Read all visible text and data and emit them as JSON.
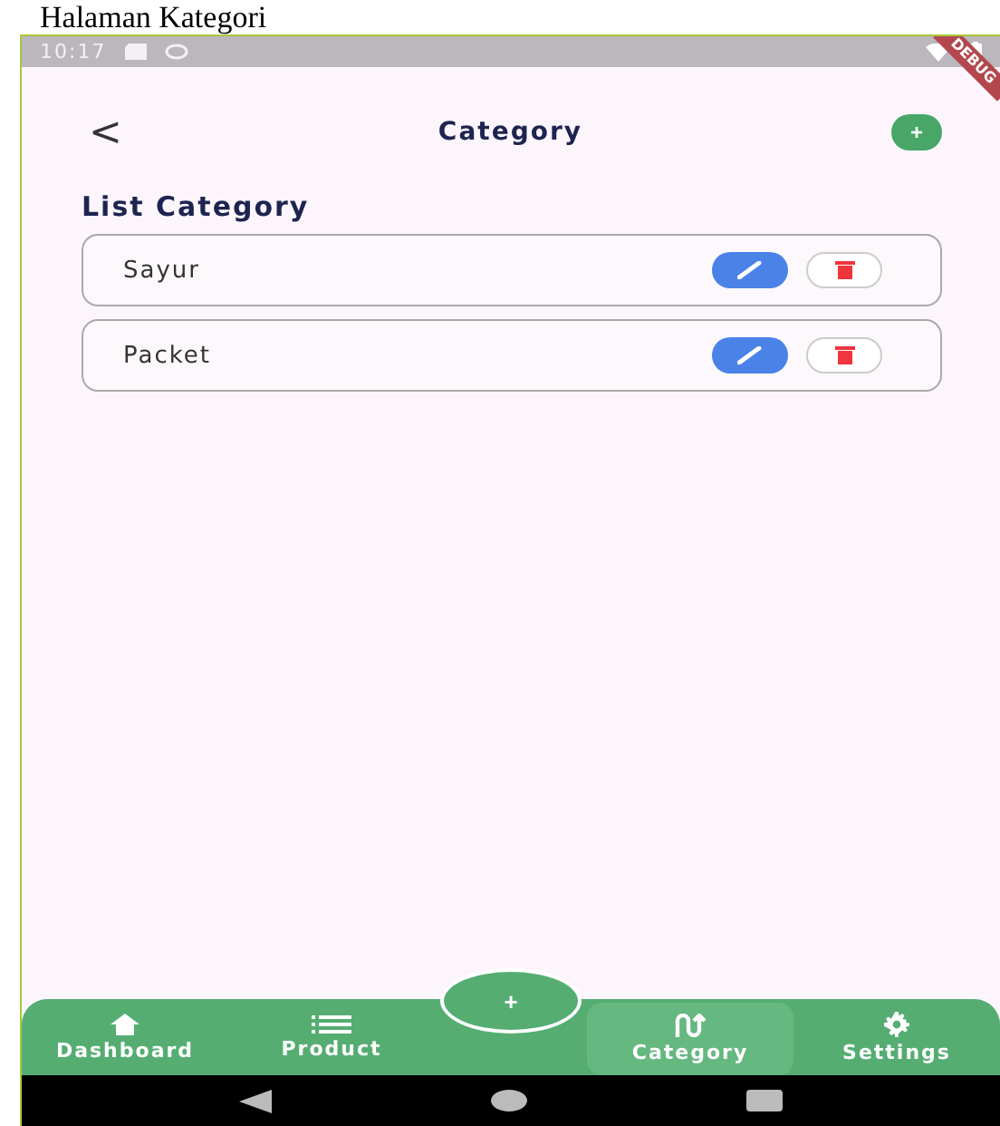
{
  "caption": "Halaman Kategori",
  "status_bar": {
    "time": "10:17"
  },
  "debug_banner": "DEBUG",
  "header": {
    "back": "<",
    "title": "Category",
    "add": "+"
  },
  "section_title": "List Category",
  "categories": [
    {
      "name": "Sayur"
    },
    {
      "name": "Packet"
    }
  ],
  "fab": "+",
  "nav": [
    {
      "label": "Dashboard",
      "kind": "home",
      "selected": false
    },
    {
      "label": "Product",
      "kind": "list",
      "selected": false
    },
    {
      "label": "Category",
      "kind": "route",
      "selected": true
    },
    {
      "label": "Settings",
      "kind": "gear",
      "selected": false
    }
  ]
}
